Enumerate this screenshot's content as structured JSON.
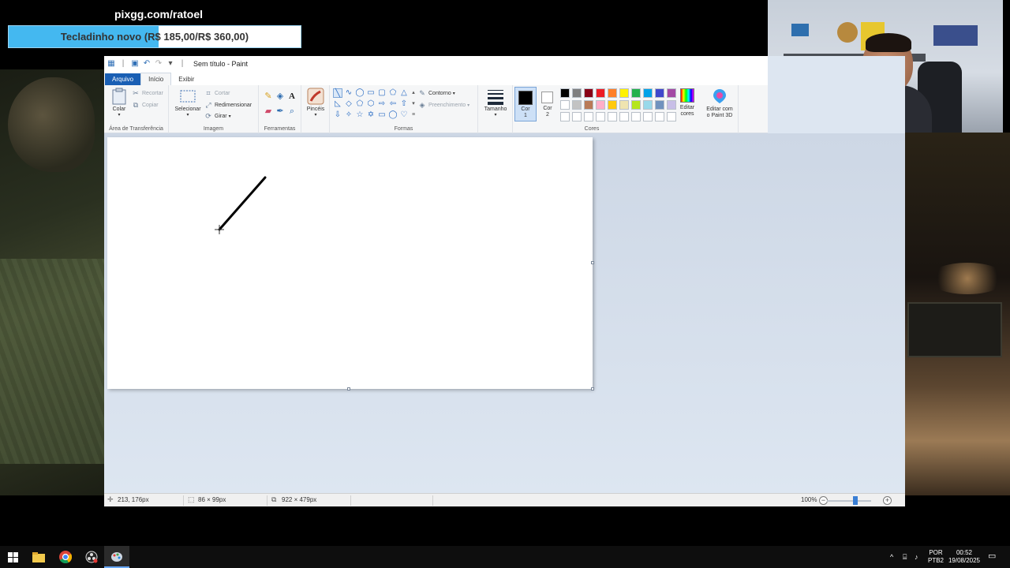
{
  "stream": {
    "pix_url": "pixgg.com/ratoel",
    "goal_text": "Tecladinho novo (R$ 185,00/R$ 360,00)",
    "goal_current": 185,
    "goal_total": 360
  },
  "paint": {
    "window_title": "Sem título - Paint",
    "tabs": [
      "Arquivo",
      "Início",
      "Exibir"
    ],
    "ribbon": {
      "clipboard": {
        "label": "Área de Transferência",
        "paste": "Colar",
        "cut": "Recortar",
        "copy": "Copiar"
      },
      "image": {
        "label": "Imagem",
        "select": "Selecionar",
        "crop": "Cortar",
        "resize": "Redimensionar",
        "rotate": "Girar"
      },
      "tools": {
        "label": "Ferramentas"
      },
      "brushes": {
        "label": "Pincéis"
      },
      "shapes": {
        "label": "Formas",
        "outline": "Contorno",
        "fill": "Preenchimento"
      },
      "size": {
        "label": "Tamanho"
      },
      "colors": {
        "label": "Cores",
        "color1_label": "Cor",
        "color1_num": "1",
        "color2_label": "Cor",
        "color2_num": "2",
        "color1_value": "#000000",
        "color2_value": "#ffffff",
        "edit_colors_line1": "Editar",
        "edit_colors_line2": "cores",
        "paint3d_line1": "Editar com",
        "paint3d_line2": "o Paint 3D",
        "palette_row1": [
          "#000000",
          "#7f7f7f",
          "#880015",
          "#ed1c24",
          "#ff7f27",
          "#fff200",
          "#22b14c",
          "#00a2e8",
          "#3f48cc",
          "#a349a4"
        ],
        "palette_row2": [
          "#ffffff",
          "#c3c3c3",
          "#b97a57",
          "#ffaec9",
          "#ffc90e",
          "#efe4b0",
          "#b5e61d",
          "#99d9ea",
          "#7092be",
          "#c8bfe7"
        ],
        "palette_row3": [
          "#ffffff",
          "#ffffff",
          "#ffffff",
          "#ffffff",
          "#ffffff",
          "#ffffff",
          "#ffffff",
          "#ffffff",
          "#ffffff",
          "#ffffff"
        ]
      }
    },
    "status": {
      "cursor_pos": "213, 176px",
      "selection_size": "86 × 99px",
      "image_size": "922 × 479px",
      "zoom": "100%"
    }
  },
  "taskbar": {
    "lang_line1": "POR",
    "lang_line2": "PTB2",
    "time": "00:52",
    "date": "19/08/2025"
  }
}
